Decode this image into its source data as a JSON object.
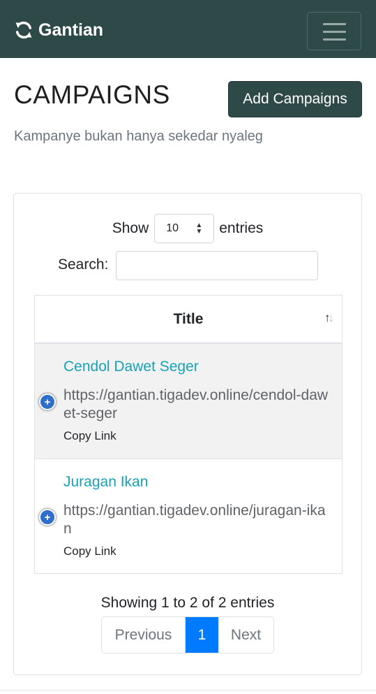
{
  "navbar": {
    "brand": "Gantian",
    "brand_icon": "refresh-icon",
    "toggle_icon": "hamburger-menu-icon",
    "color": "#2e4a48"
  },
  "header": {
    "title": "CAMPAIGNS",
    "add_button": "Add Campaigns",
    "subtitle": "Kampanye bukan hanya sekedar nyaleg"
  },
  "table_controls": {
    "show_label": "Show",
    "page_length": "10",
    "entries_label": "entries",
    "search_label": "Search:",
    "search_value": ""
  },
  "table": {
    "column_header": "Title",
    "sort_icon": "sort-both-icon",
    "rows": [
      {
        "title": "Cendol Dawet Seger",
        "url": "https://gantian.tigadev.online/cendol-dawet-seger",
        "copy_label": "Copy Link"
      },
      {
        "title": "Juragan Ikan",
        "url": "https://gantian.tigadev.online/juragan-ikan",
        "copy_label": "Copy Link"
      }
    ]
  },
  "footer_info": "Showing 1 to 2 of 2 entries",
  "pagination": {
    "previous": "Previous",
    "current": "1",
    "next": "Next"
  },
  "colors": {
    "primary": "#2e4a48",
    "link": "#17a2b8",
    "active_page": "#007bff"
  }
}
